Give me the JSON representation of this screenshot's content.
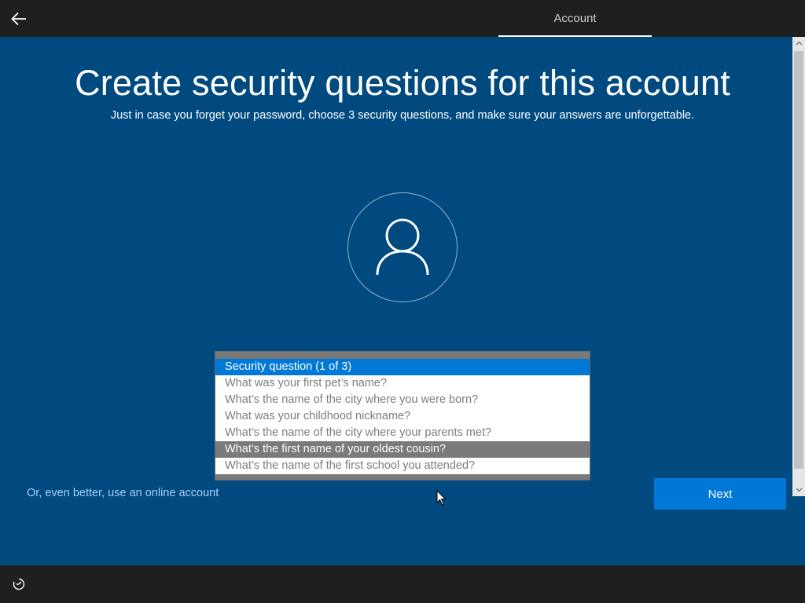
{
  "header": {
    "back_icon": "back-arrow-icon",
    "tab_label": "Account"
  },
  "main": {
    "title": "Create security questions for this account",
    "subtitle": "Just in case you forget your password, choose 3 security questions, and make sure your answers are unforgettable.",
    "avatar_icon": "user-icon"
  },
  "dropdown": {
    "options": [
      {
        "label": "Security question (1 of 3)",
        "state": "selected"
      },
      {
        "label": "What was your first pet’s name?",
        "state": "normal"
      },
      {
        "label": "What’s the name of the city where you were born?",
        "state": "normal"
      },
      {
        "label": "What was your childhood nickname?",
        "state": "normal"
      },
      {
        "label": "What’s the name of the city where your parents met?",
        "state": "normal"
      },
      {
        "label": "What’s the first name of your oldest cousin?",
        "state": "hovered"
      },
      {
        "label": "What’s the name of the first school you attended?",
        "state": "normal"
      }
    ]
  },
  "footer": {
    "online_account_link": "Or, even better, use an online account",
    "next_label": "Next",
    "ease_icon": "ease-of-access-icon"
  },
  "colors": {
    "background": "#004a80",
    "accent": "#0078d7",
    "bar": "#1f1f1f",
    "link": "#a6d0f5"
  }
}
